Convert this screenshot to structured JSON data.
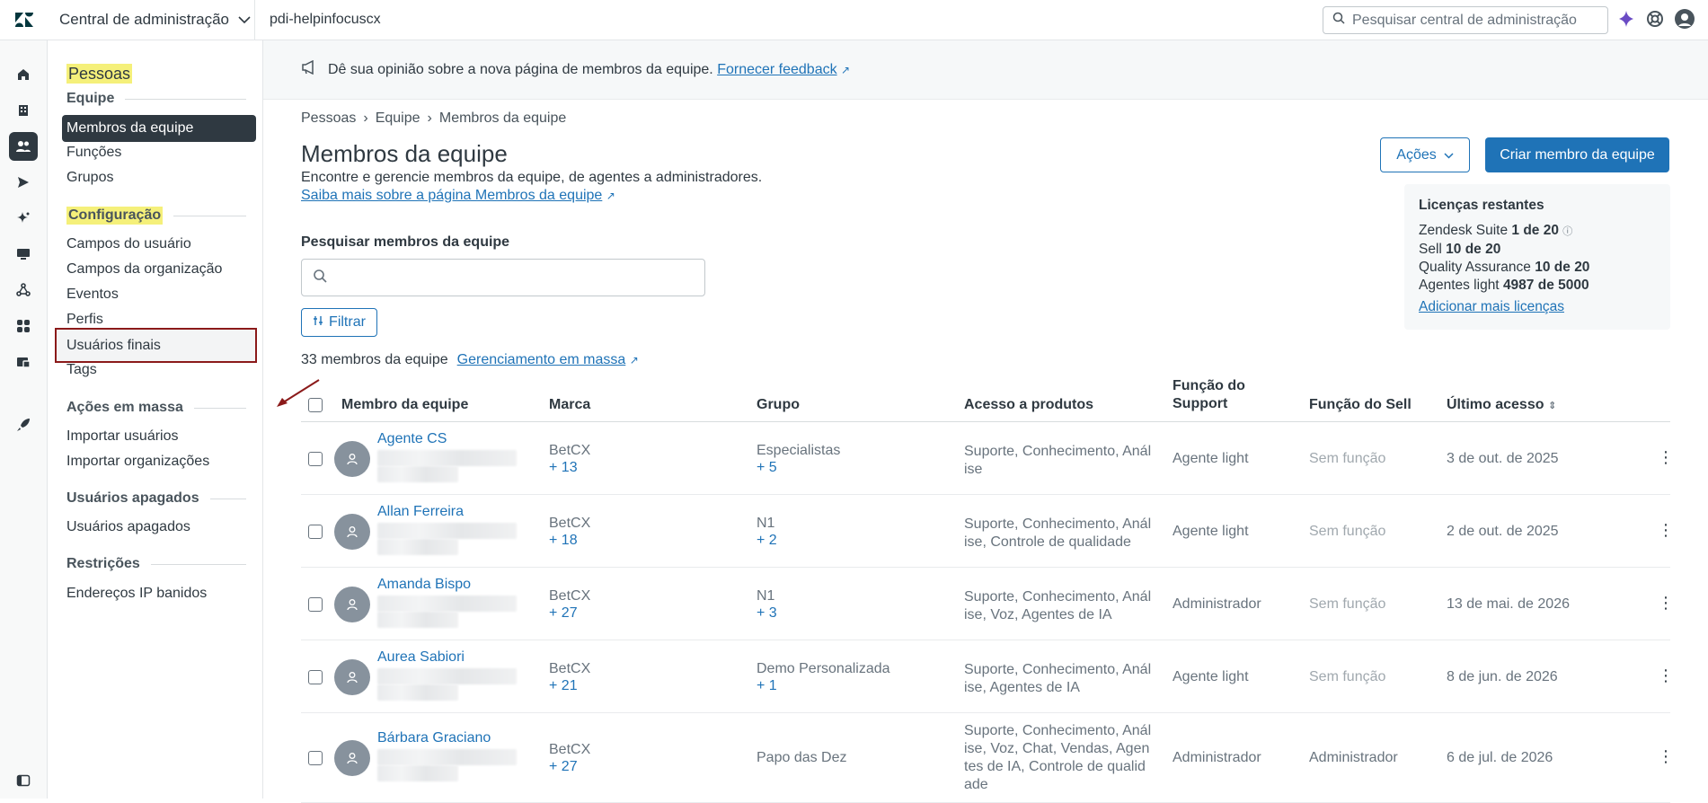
{
  "topbar": {
    "product": "Central de administração",
    "account": "pdi-helpinfocuscx",
    "search_placeholder": "Pesquisar central de administração"
  },
  "sidenav": {
    "title": "Pessoas",
    "sections": [
      {
        "title": "Equipe",
        "items": [
          "Membros da equipe",
          "Funções",
          "Grupos"
        ]
      },
      {
        "title": "Configuração",
        "items": [
          "Campos do usuário",
          "Campos da organização",
          "Eventos",
          "Perfis",
          "Usuários finais",
          "Tags"
        ]
      },
      {
        "title": "Ações em massa",
        "items": [
          "Importar usuários",
          "Importar organizações"
        ]
      },
      {
        "title": "Usuários apagados",
        "items": [
          "Usuários apagados"
        ]
      },
      {
        "title": "Restrições",
        "items": [
          "Endereços IP banidos"
        ]
      }
    ]
  },
  "banner": {
    "text": "Dê sua opinião sobre a nova página de membros da equipe.",
    "link": "Fornecer feedback"
  },
  "breadcrumb": [
    "Pessoas",
    "Equipe",
    "Membros da equipe"
  ],
  "page": {
    "title": "Membros da equipe",
    "description": "Encontre e gerencie membros da equipe, de agentes a administradores.",
    "learn_more": "Saiba mais sobre a página Membros da equipe",
    "actions_label": "Ações",
    "create_label": "Criar membro da equipe",
    "search_label": "Pesquisar membros da equipe",
    "filter_label": "Filtrar",
    "count_text": "33 membros da equipe",
    "bulk_link": "Gerenciamento em massa"
  },
  "licenses": {
    "heading": "Licenças restantes",
    "items": [
      {
        "label": "Zendesk Suite",
        "value": "1 de 20"
      },
      {
        "label": "Sell",
        "value": "10 de 20"
      },
      {
        "label": "Quality Assurance",
        "value": "10 de 20"
      },
      {
        "label": "Agentes light",
        "value": "4987 de 5000"
      }
    ],
    "add_link": "Adicionar mais licenças"
  },
  "table": {
    "columns": [
      "Membro da equipe",
      "Marca",
      "Grupo",
      "Acesso a produtos",
      "Função do Support",
      "Função do Sell",
      "Último acesso"
    ],
    "rows": [
      {
        "name": "Agente CS",
        "brand": "BetCX",
        "brand_more": "+ 13",
        "group": "Especialistas",
        "group_more": "+ 5",
        "access": "Suporte, Conhecimento, Análise",
        "support_role": "Agente light",
        "sell_role": "Sem função",
        "last": "3 de out. de 2025"
      },
      {
        "name": "Allan Ferreira",
        "brand": "BetCX",
        "brand_more": "+ 18",
        "group": "N1",
        "group_more": "+ 2",
        "access": "Suporte, Conhecimento, Análise, Controle de qualidade",
        "support_role": "Agente light",
        "sell_role": "Sem função",
        "last": "2 de out. de 2025"
      },
      {
        "name": "Amanda Bispo",
        "brand": "BetCX",
        "brand_more": "+ 27",
        "group": "N1",
        "group_more": "+ 3",
        "access": "Suporte, Conhecimento, Análise, Voz, Agentes de IA",
        "support_role": "Administrador",
        "sell_role": "Sem função",
        "last": "13 de mai. de 2026"
      },
      {
        "name": "Aurea Sabiori",
        "brand": "BetCX",
        "brand_more": "+ 21",
        "group": "Demo Personalizada",
        "group_more": "+ 1",
        "access": "Suporte, Conhecimento, Análise, Agentes de IA",
        "support_role": "Agente light",
        "sell_role": "Sem função",
        "last": "8 de jun. de 2026"
      },
      {
        "name": "Bárbara Graciano",
        "brand": "BetCX",
        "brand_more": "+ 27",
        "group": "Papo das Dez",
        "group_more": "",
        "access": "Suporte, Conhecimento, Análise, Voz, Chat, Vendas, Agentes de IA, Controle de qualidade",
        "support_role": "Administrador",
        "sell_role": "Administrador",
        "last": "6 de jul. de 2026"
      }
    ]
  },
  "colors": {
    "accent": "#1f73b7",
    "nav_active": "#2f3941",
    "highlight": "#f5f07a",
    "annotation": "#8b1a1a"
  }
}
